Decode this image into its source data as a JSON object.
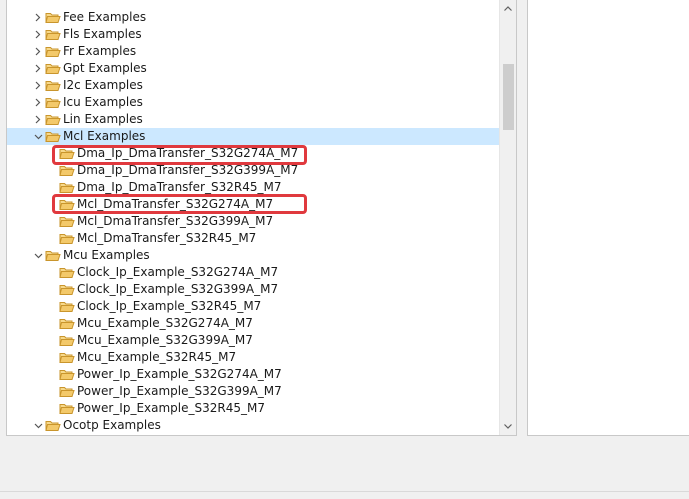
{
  "tree": {
    "items": [
      {
        "label": "Fee Examples",
        "expanded": false,
        "level": 1
      },
      {
        "label": "Fls Examples",
        "expanded": false,
        "level": 1
      },
      {
        "label": "Fr Examples",
        "expanded": false,
        "level": 1
      },
      {
        "label": "Gpt Examples",
        "expanded": false,
        "level": 1
      },
      {
        "label": "I2c Examples",
        "expanded": false,
        "level": 1
      },
      {
        "label": "Icu Examples",
        "expanded": false,
        "level": 1
      },
      {
        "label": "Lin Examples",
        "expanded": false,
        "level": 1
      },
      {
        "label": "Mcl Examples",
        "expanded": true,
        "level": 1,
        "selected": true
      },
      {
        "label": "Dma_Ip_DmaTransfer_S32G274A_M7",
        "level": 2,
        "highlighted": true
      },
      {
        "label": "Dma_Ip_DmaTransfer_S32G399A_M7",
        "level": 2
      },
      {
        "label": "Dma_Ip_DmaTransfer_S32R45_M7",
        "level": 2
      },
      {
        "label": "Mcl_DmaTransfer_S32G274A_M7",
        "level": 2,
        "highlighted": true
      },
      {
        "label": "Mcl_DmaTransfer_S32G399A_M7",
        "level": 2
      },
      {
        "label": "Mcl_DmaTransfer_S32R45_M7",
        "level": 2
      },
      {
        "label": "Mcu Examples",
        "expanded": true,
        "level": 1
      },
      {
        "label": "Clock_Ip_Example_S32G274A_M7",
        "level": 2
      },
      {
        "label": "Clock_Ip_Example_S32G399A_M7",
        "level": 2
      },
      {
        "label": "Clock_Ip_Example_S32R45_M7",
        "level": 2
      },
      {
        "label": "Mcu_Example_S32G274A_M7",
        "level": 2
      },
      {
        "label": "Mcu_Example_S32G399A_M7",
        "level": 2
      },
      {
        "label": "Mcu_Example_S32R45_M7",
        "level": 2
      },
      {
        "label": "Power_Ip_Example_S32G274A_M7",
        "level": 2
      },
      {
        "label": "Power_Ip_Example_S32G399A_M7",
        "level": 2
      },
      {
        "label": "Power_Ip_Example_S32R45_M7",
        "level": 2
      },
      {
        "label": "Ocotp Examples",
        "expanded": true,
        "level": 1
      }
    ]
  },
  "colors": {
    "selection": "#cce8ff",
    "highlight": "#e0393e",
    "folder_fill": "#f3c96a",
    "folder_stroke": "#c9952c"
  }
}
